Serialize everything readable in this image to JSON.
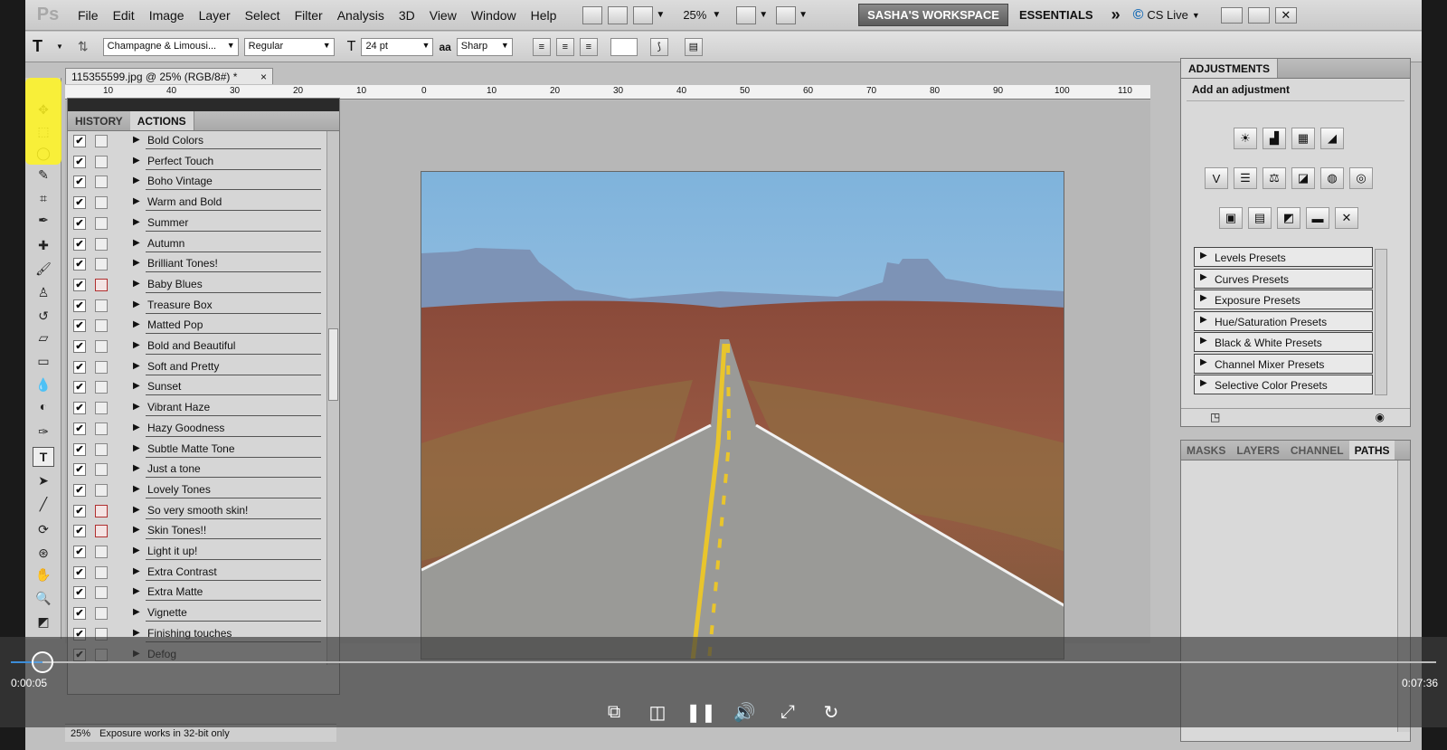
{
  "app": {
    "logo": "Ps"
  },
  "menu": [
    "File",
    "Edit",
    "Image",
    "Layer",
    "Select",
    "Filter",
    "Analysis",
    "3D",
    "View",
    "Window",
    "Help"
  ],
  "toolbar": {
    "zoom": "25%",
    "workspace": "SASHA'S WORKSPACE",
    "essentials": "ESSENTIALS",
    "more": "»",
    "cslive": "CS Live"
  },
  "options": {
    "font_family": "Champagne & Limousi...",
    "font_style": "Regular",
    "font_size": "24 pt",
    "aa_label": "aa",
    "antialias": "Sharp"
  },
  "document": {
    "tab_title": "115355599.jpg @ 25% (RGB/8#) *",
    "close": "×"
  },
  "ruler": [
    "10",
    "10",
    "40",
    "30",
    "20",
    "10",
    "0",
    "10",
    "20",
    "30",
    "40",
    "50",
    "60",
    "70",
    "80",
    "90",
    "100",
    "110"
  ],
  "panel_left": {
    "tabs": [
      "HISTORY",
      "ACTIONS"
    ]
  },
  "actions": [
    {
      "name": "Bold Colors",
      "dialog": false
    },
    {
      "name": "Perfect Touch",
      "dialog": false
    },
    {
      "name": "Boho Vintage",
      "dialog": false
    },
    {
      "name": "Warm and Bold",
      "dialog": false
    },
    {
      "name": "Summer",
      "dialog": false
    },
    {
      "name": "Autumn",
      "dialog": false
    },
    {
      "name": "Brilliant Tones!",
      "dialog": false
    },
    {
      "name": "Baby Blues",
      "dialog": true
    },
    {
      "name": "Treasure Box",
      "dialog": false
    },
    {
      "name": "Matted Pop",
      "dialog": false
    },
    {
      "name": "Bold and Beautiful",
      "dialog": false
    },
    {
      "name": "Soft and Pretty",
      "dialog": false
    },
    {
      "name": "Sunset",
      "dialog": false
    },
    {
      "name": "Vibrant Haze",
      "dialog": false
    },
    {
      "name": "Hazy Goodness",
      "dialog": false
    },
    {
      "name": "Subtle Matte Tone",
      "dialog": false
    },
    {
      "name": "Just a tone",
      "dialog": false
    },
    {
      "name": "Lovely Tones",
      "dialog": false
    },
    {
      "name": "So very smooth skin!",
      "dialog": true
    },
    {
      "name": "Skin Tones!!",
      "dialog": true
    },
    {
      "name": "Light it up!",
      "dialog": false
    },
    {
      "name": "Extra Contrast",
      "dialog": false
    },
    {
      "name": "Extra Matte",
      "dialog": false
    },
    {
      "name": "Vignette",
      "dialog": false
    },
    {
      "name": "Finishing touches",
      "dialog": false
    },
    {
      "name": "Defog",
      "dialog": false
    }
  ],
  "adjustments": {
    "tab": "ADJUSTMENTS",
    "subtitle": "Add an adjustment",
    "presets": [
      "Levels Presets",
      "Curves Presets",
      "Exposure Presets",
      "Hue/Saturation Presets",
      "Black & White Presets",
      "Channel Mixer Presets",
      "Selective Color Presets"
    ]
  },
  "layers_panel": {
    "tabs": [
      "MASKS",
      "LAYERS",
      "CHANNEL",
      "PATHS"
    ]
  },
  "status": {
    "zoom": "25%",
    "message": "Exposure works in 32-bit only"
  },
  "video": {
    "current": "0:00:05",
    "total": "0:07:36",
    "progress": 0.011
  }
}
